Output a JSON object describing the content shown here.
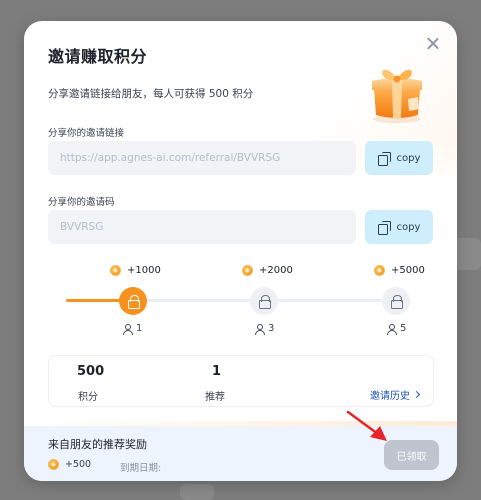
{
  "modal": {
    "title": "邀请赚取积分",
    "subtitle": "分享邀请链接给朋友，每人可获得 500 积分",
    "link_label": "分享你的邀请链接",
    "link_value": "https://app.agnes-ai.com/referral/BVVRSG",
    "code_label": "分享你的邀请码",
    "code_value": "BVVRSG",
    "copy_label": "copy"
  },
  "milestones": [
    {
      "reward": "+1000",
      "count": "1",
      "state": "unlocked"
    },
    {
      "reward": "+2000",
      "count": "3",
      "state": "locked"
    },
    {
      "reward": "+5000",
      "count": "5",
      "state": "locked"
    }
  ],
  "progress": 0.2,
  "stats": {
    "points_value": "500",
    "points_label": "积分",
    "referrals_value": "1",
    "referrals_label": "推荐",
    "history_link": "邀请历史"
  },
  "footer": {
    "title": "来自朋友的推荐奖励",
    "amount": "+500",
    "expiry_label": "到期日期:",
    "claim_button": "已领取"
  },
  "colors": {
    "accent_orange": "#f7921e",
    "copy_button_bg": "#cdeefa",
    "link_blue": "#1f54b5",
    "annotation_red": "#e8242b",
    "disabled_button": "#bfc4cf"
  },
  "icons": [
    "close-icon",
    "gift-box-icon",
    "copy-icon",
    "coin-icon",
    "lock-icon",
    "user-icon",
    "chevron-right-icon"
  ]
}
